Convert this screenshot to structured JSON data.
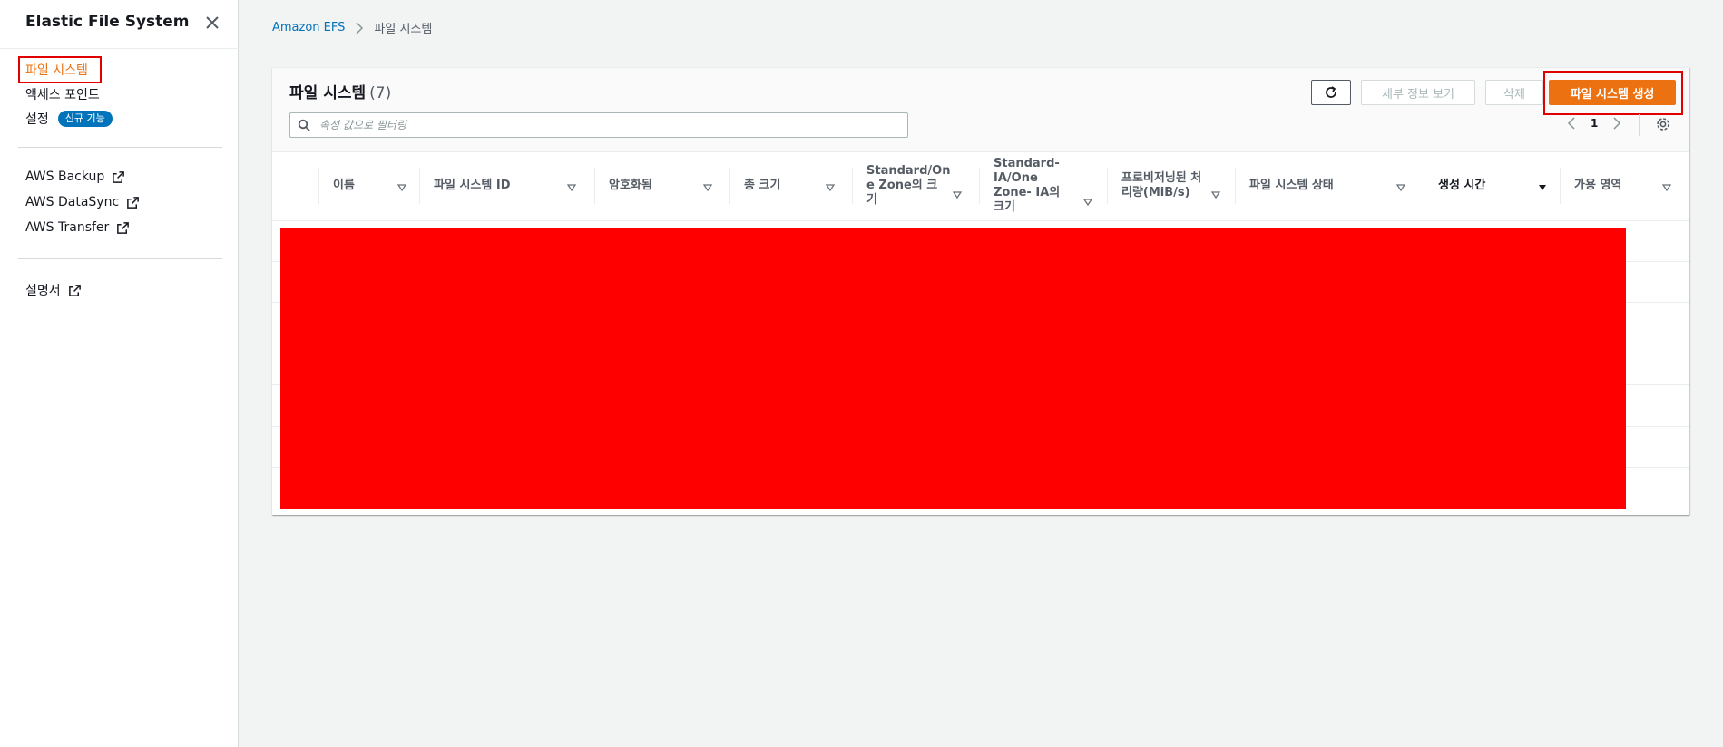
{
  "sidebar": {
    "title": "Elastic File System",
    "items": [
      {
        "label": "파일 시스템",
        "active": true
      },
      {
        "label": "액세스 포인트"
      },
      {
        "label": "설정",
        "badge": "신규 기능"
      }
    ],
    "links": [
      {
        "label": "AWS Backup",
        "icon": "external-link-icon"
      },
      {
        "label": "AWS DataSync",
        "icon": "external-link-icon"
      },
      {
        "label": "AWS Transfer",
        "icon": "external-link-icon"
      }
    ],
    "docs": {
      "label": "설명서",
      "icon": "external-link-icon"
    }
  },
  "breadcrumb": {
    "root": "Amazon EFS",
    "current": "파일 시스템"
  },
  "panel": {
    "title": "파일 시스템",
    "count": "(7)",
    "buttons": {
      "details": "세부 정보 보기",
      "delete": "삭제",
      "create": "파일 시스템 생성"
    },
    "filter_placeholder": "속성 값으로 필터링",
    "page": "1"
  },
  "table": {
    "columns": [
      {
        "label": "이름"
      },
      {
        "label": "파일 시스템 ID"
      },
      {
        "label": "암호화됨"
      },
      {
        "label": "총 크기"
      },
      {
        "label": "Standard/On e Zone의 크기"
      },
      {
        "label": "Standard- IA/One Zone- IA의 크기"
      },
      {
        "label": "프로비저닝된 처리량(MiB/s)"
      },
      {
        "label": "파일 시스템 상태"
      },
      {
        "label": "생성 시간",
        "sorted": "desc"
      },
      {
        "label": "가용 영역"
      }
    ],
    "row_count": 7
  },
  "colors": {
    "accent": "#ec7211",
    "link": "#0073bb",
    "badge": "#0073bb",
    "highlight": "#e00000",
    "redaction": "#ff0000"
  }
}
